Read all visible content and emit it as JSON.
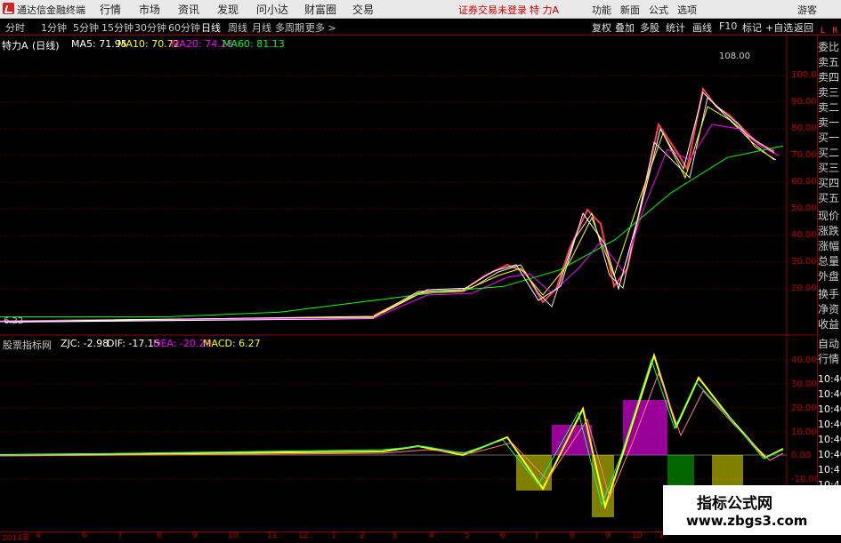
{
  "menubar": {
    "app_title": "通达信金融终端",
    "items": [
      "行情",
      "市场",
      "资讯",
      "发现",
      "问小达",
      "财富圈",
      "交易"
    ],
    "login_status": "证券交易未登录",
    "stock_name": "特 力A",
    "right_items": [
      "功能",
      "新面",
      "公式",
      "选项"
    ],
    "guest": "游客"
  },
  "toolbar": {
    "periods": [
      "分时",
      "1分钟",
      "5分钟",
      "15分钟",
      "30分钟",
      "60分钟",
      "日线",
      "周线",
      "月线",
      "多周期",
      "更多 >"
    ],
    "active_period": "日线",
    "right_buttons": [
      "复权",
      "叠加",
      "多股",
      "统计",
      "画线",
      "F10",
      "标记",
      "+自选",
      "返回"
    ]
  },
  "price_panel": {
    "stock_label": "特力A",
    "period_tag": "(日线)",
    "ma5": "MA5: 71.95",
    "ma10": "MA10: 70.72",
    "ma20": "MA20: 74.28",
    "ma60": "MA60: 81.13",
    "low_marker": "6.22",
    "high_marker": "108.00",
    "y_ticks": [
      "100.0",
      "90.00",
      "80.00",
      "70.00",
      "60.00",
      "50.00",
      "40.00",
      "30.00",
      "20.00"
    ],
    "colors": {
      "ma5": "#ffffff",
      "ma10": "#ffff00",
      "ma20": "#ff00ff",
      "ma60": "#00ff00"
    }
  },
  "indicator_panel": {
    "name": "股票指标网",
    "zjc": "ZJC: -2.98",
    "dif": "DIF: -17.15",
    "dea": "DEA: -20.29",
    "macd": "MACD: 6.27",
    "y_ticks": [
      "40.00",
      "30.00",
      "20.00",
      "10.00",
      "0.00",
      "-10.00"
    ]
  },
  "right_column": {
    "labels": [
      "委比",
      "卖五",
      "卖四",
      "卖三",
      "卖二",
      "卖一",
      "买一",
      "买二",
      "买三",
      "买四",
      "买五",
      "现价",
      "涨跌",
      "涨幅",
      "总量",
      "外盘",
      "换手",
      "净资",
      "收益",
      "自动",
      "行情"
    ],
    "times": [
      "10:40",
      "10:40",
      "10:40",
      "10:40",
      "10:40",
      "10:40",
      "10:41",
      "10:41"
    ],
    "corner_l": "L",
    "corner_r": "R"
  },
  "date_axis": {
    "labels": [
      "2014年",
      "4",
      "6",
      "7",
      "8",
      "9",
      "10",
      "11",
      "12",
      "1",
      "2",
      "3",
      "4",
      "5",
      "6",
      "7",
      "8",
      "9",
      "10",
      "1"
    ]
  },
  "watermark": {
    "line1": "指标公式网",
    "line2": "www.zbgs3.com"
  },
  "chart_data": {
    "type": "line",
    "series": [
      {
        "name": "MA60",
        "values": [
          7,
          7,
          7,
          7,
          8,
          9,
          12,
          15,
          18,
          20,
          27,
          40,
          60,
          75,
          80
        ]
      }
    ],
    "ylim": [
      0,
      110
    ]
  }
}
